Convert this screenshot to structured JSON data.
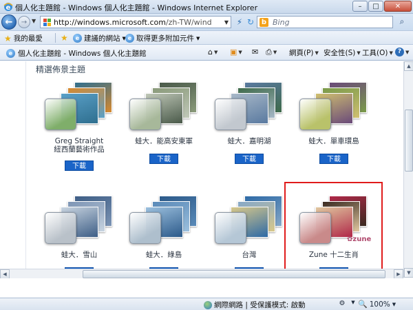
{
  "window": {
    "title": "個人化主題館 - Windows 個人化主題館 - Windows Internet Explorer",
    "minimize": "–",
    "maximize": "□",
    "close": "✕"
  },
  "address": {
    "url_host": "http://windows.microsoft.com",
    "url_path": "/zh-TW/windows/downloa",
    "search_placeholder": "Bing"
  },
  "favorites": {
    "favorites_label": "我的最愛",
    "suggested_sites": "建議的網站",
    "get_addons": "取得更多附加元件"
  },
  "tab": {
    "title": "個人化主題館 - Windows 個人化主題館"
  },
  "commands": {
    "page": "網頁(P)",
    "safety": "安全性(S)",
    "tools": "工具(O)"
  },
  "content": {
    "section_title": "精選佈景主題",
    "download_label": "下載",
    "themes": [
      {
        "name_line1": "Greg Straight",
        "name_line2": "紐西蘭藝術作品",
        "colors": [
          "#2f6f8f",
          "#d8892e",
          "#5aa0c8"
        ],
        "glass": "#7fae6a"
      },
      {
        "name_line1": "蛙大．能高安東軍",
        "name_line2": "",
        "colors": [
          "#4a5a4a",
          "#8a9a7a",
          "#c0c8b8"
        ],
        "glass": "#a7b89a"
      },
      {
        "name_line1": "蛙大．嘉明湖",
        "name_line2": "",
        "colors": [
          "#5a7aa0",
          "#3e6a4a",
          "#a8b8c8"
        ],
        "glass": "#c2c8cf"
      },
      {
        "name_line1": "蛙大．單車環島",
        "name_line2": "",
        "colors": [
          "#6a4a7a",
          "#7a9a4a",
          "#d0c070"
        ],
        "glass": "#b9c26a"
      },
      {
        "name_line1": "蛙大．雪山",
        "name_line2": "",
        "colors": [
          "#3e5e86",
          "#7c94b4",
          "#c8d4e0"
        ],
        "glass": "#b9c1c9"
      },
      {
        "name_line1": "蛙大．綠島",
        "name_line2": "",
        "colors": [
          "#2c5a8a",
          "#5a8ab8",
          "#9cc0de"
        ],
        "glass": "#aebfcd"
      },
      {
        "name_line1": "台灣",
        "name_line2": "",
        "colors": [
          "#2e6aa6",
          "#86a8c8",
          "#d8c88a"
        ],
        "glass": "#b5c7d6"
      },
      {
        "name_line1": "Zune 十二生肖",
        "name_line2": "",
        "colors": [
          "#b02848",
          "#3a2a20",
          "#e0c8a0"
        ],
        "glass": "#c98a8a"
      }
    ],
    "zune_logo": "✿zune"
  },
  "status": {
    "zone": "網際網路 | 受保護模式: 啟動",
    "zoom": "100%"
  }
}
